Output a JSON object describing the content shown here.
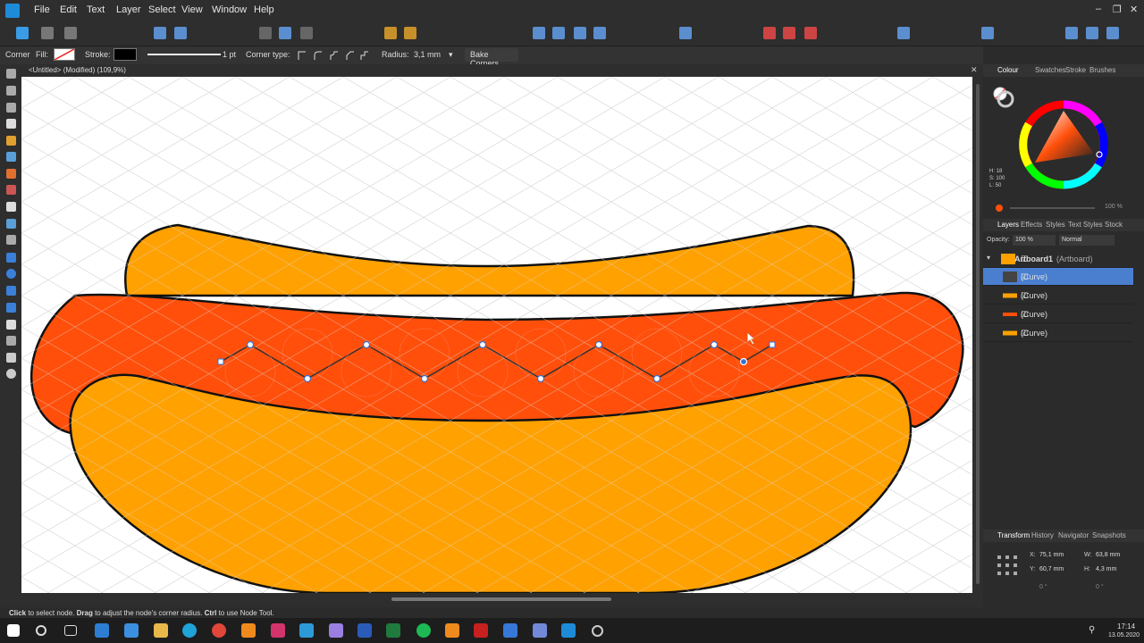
{
  "menubar": {
    "items": [
      "File",
      "Edit",
      "Text",
      "Layer",
      "Select",
      "View",
      "Window",
      "Help"
    ]
  },
  "context": {
    "tool_name": "Corner",
    "fill_label": "Fill:",
    "stroke_label": "Stroke:",
    "stroke_width": "1 pt",
    "corner_type_label": "Corner type:",
    "radius_label": "Radius:",
    "radius_value": "3,1 mm",
    "bake_corners": "Bake Corners"
  },
  "document": {
    "tab_title": "<Untitled> (Modified) (109,9%)"
  },
  "colour_panel": {
    "tabs": [
      "Colour",
      "Swatches",
      "Stroke",
      "Brushes"
    ],
    "h": "H: 18",
    "s": "S: 100",
    "l": "L: 50",
    "opacity": "100 %"
  },
  "layers_panel": {
    "tabs": [
      "Layers",
      "Effects",
      "Styles",
      "Text Styles",
      "Stock"
    ],
    "opacity_label": "Opacity:",
    "opacity_value": "100 %",
    "blend_mode": "Normal",
    "artboard": "Artboard1",
    "artboard_suffix": "(Artboard)",
    "layers": [
      {
        "name": "(Curve)",
        "selected": true
      },
      {
        "name": "(Curve)",
        "selected": false
      },
      {
        "name": "(Curve)",
        "selected": false
      },
      {
        "name": "(Curve)",
        "selected": false
      }
    ]
  },
  "transform_panel": {
    "tabs": [
      "Transform",
      "History",
      "Navigator",
      "Snapshots"
    ],
    "x_label": "X:",
    "x_value": "75,1 mm",
    "y_label": "Y:",
    "y_value": "60,7 mm",
    "w_label": "W:",
    "w_value": "63,8 mm",
    "h_label": "H:",
    "h_value": "4,3 mm",
    "r_value": "0 °",
    "s_value": "0 °"
  },
  "status_bar": {
    "text_1": "Click",
    "text_2": " to select node. ",
    "text_3": "Drag",
    "text_4": " to adjust the node's corner radius. ",
    "text_5": "Ctrl",
    "text_6": " to use Node Tool."
  },
  "taskbar": {
    "time": "17:14",
    "date": "13.05.2020"
  },
  "colors": {
    "bun": "#ffa100",
    "sausage": "#ff4f0a",
    "accent": "#4a7fd0"
  }
}
